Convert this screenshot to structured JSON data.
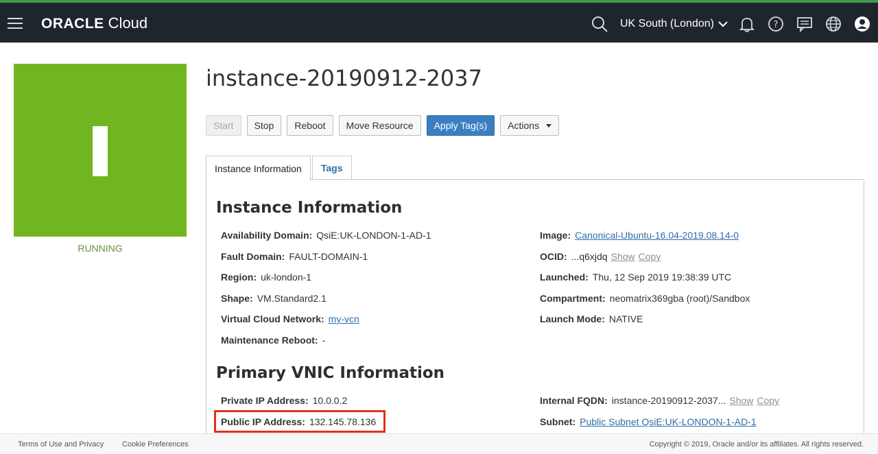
{
  "header": {
    "brand_oracle": "ORACLE",
    "brand_cloud": "Cloud",
    "region": "UK South (London)",
    "icons": [
      "menu-icon",
      "search-icon",
      "chevron-down-icon",
      "bell-icon",
      "help-icon",
      "chat-icon",
      "globe-icon",
      "user-icon"
    ]
  },
  "instance": {
    "status": "RUNNING",
    "title": "instance-20190912-2037",
    "status_color": "#71b521"
  },
  "toolbar": {
    "start": "Start",
    "stop": "Stop",
    "reboot": "Reboot",
    "move": "Move Resource",
    "apply_tags": "Apply Tag(s)",
    "actions": "Actions"
  },
  "tabs": [
    {
      "label": "Instance Information",
      "active": true
    },
    {
      "label": "Tags",
      "active": false
    }
  ],
  "info": {
    "heading": "Instance Information",
    "left": [
      {
        "key": "Availability Domain:",
        "value": "QsiE:UK-LONDON-1-AD-1"
      },
      {
        "key": "Fault Domain:",
        "value": "FAULT-DOMAIN-1"
      },
      {
        "key": "Region:",
        "value": "uk-london-1"
      },
      {
        "key": "Shape:",
        "value": "VM.Standard2.1"
      },
      {
        "key": "Virtual Cloud Network:",
        "value": "my-vcn"
      },
      {
        "key": "Maintenance Reboot:",
        "value": "-"
      }
    ],
    "right": [
      {
        "key": "Image:",
        "value": "Canonical-Ubuntu-16.04-2019.08.14-0"
      },
      {
        "key": "OCID:",
        "value": "...q6xjdq",
        "show": "Show",
        "copy": "Copy"
      },
      {
        "key": "Launched:",
        "value": "Thu, 12 Sep 2019 19:38:39 UTC"
      },
      {
        "key": "Compartment:",
        "value": "neomatrix369gba (root)/Sandbox"
      },
      {
        "key": "Launch Mode:",
        "value": "NATIVE"
      }
    ]
  },
  "vnic": {
    "heading": "Primary VNIC Information",
    "left": [
      {
        "key": "Private IP Address:",
        "value": "10.0.0.2"
      },
      {
        "key": "Public IP Address:",
        "value": "132.145.78.136"
      }
    ],
    "right": [
      {
        "key": "Internal FQDN:",
        "value": "instance-20190912-2037...",
        "show": "Show",
        "copy": "Copy"
      },
      {
        "key": "Subnet:",
        "value": "Public Subnet QsiE:UK-LONDON-1-AD-1"
      }
    ]
  },
  "footer": {
    "terms": "Terms of Use and Privacy",
    "cookies": "Cookie Preferences",
    "copyright": "Copyright © 2019, Oracle and/or its affiliates. All rights reserved."
  }
}
